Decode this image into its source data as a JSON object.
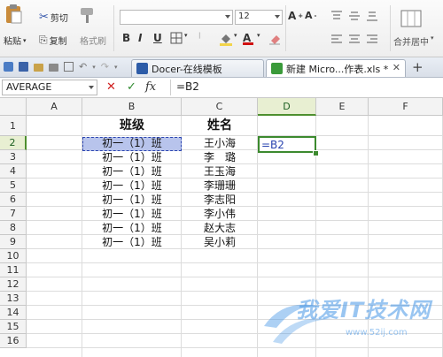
{
  "ribbon": {
    "cut_label": "剪切",
    "paste_label": "粘贴",
    "copy_label": "复制",
    "format_painter_label": "格式刷",
    "font_size": "12",
    "merge_label": "合并居中"
  },
  "tabs": [
    {
      "label": "Docer-在线模板",
      "icon_color": "#2d5ca8"
    },
    {
      "label": "新建 Micro...作表.xls *",
      "icon_color": "#3a9a3a"
    }
  ],
  "formula_bar": {
    "name_box": "AVERAGE",
    "cancel_icon": "✕",
    "confirm_icon": "✓",
    "fx_label": "fx",
    "formula": "=B2"
  },
  "columns": [
    "A",
    "B",
    "C",
    "D",
    "E",
    "F"
  ],
  "rows": [
    "1",
    "2",
    "3",
    "4",
    "5",
    "6",
    "7",
    "8",
    "9",
    "10",
    "11",
    "12",
    "13",
    "14",
    "15",
    "16"
  ],
  "table": {
    "header_class": "班级",
    "header_name": "姓名",
    "data": [
      {
        "class": "初一（1）班",
        "name": "王小海"
      },
      {
        "class": "初一（1）班",
        "name": "李　璐"
      },
      {
        "class": "初一（1）班",
        "name": "王玉海"
      },
      {
        "class": "初一（1）班",
        "name": "李珊珊"
      },
      {
        "class": "初一（1）班",
        "name": "李志阳"
      },
      {
        "class": "初一（1）班",
        "name": "李小伟"
      },
      {
        "class": "初一（1）班",
        "name": "赵大志"
      },
      {
        "class": "初一（1）班",
        "name": "吴小莉"
      }
    ]
  },
  "active_cell": {
    "ref": "D2",
    "content": "=B2"
  },
  "watermark": {
    "title": "我爱IT技术网",
    "url": "www.52ij.com"
  },
  "colors": {
    "accent_green": "#3c8a2e",
    "selection_fill": "#b8c4ec",
    "marching_border": "#2a44b0"
  }
}
